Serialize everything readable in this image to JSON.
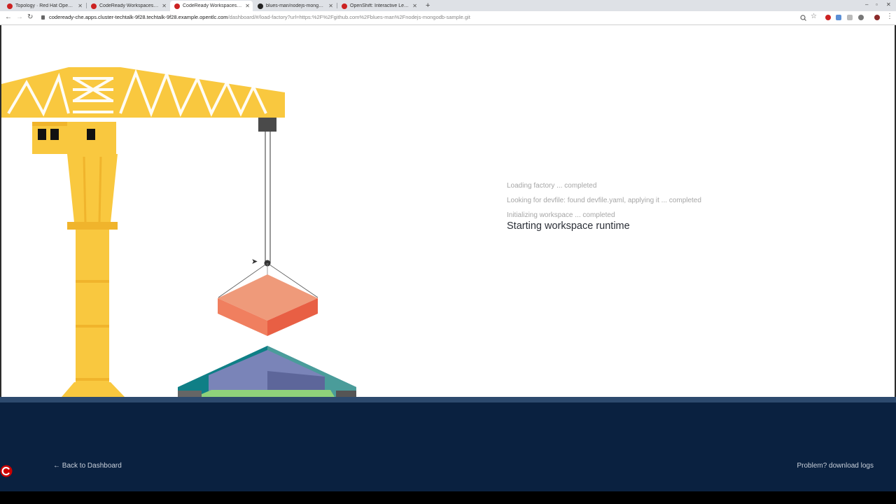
{
  "browser": {
    "tabs": [
      {
        "title": "Topology · Red Hat OpenShift",
        "favicon_color": "#cc2222",
        "active": false
      },
      {
        "title": "CodeReady Workspaces | Dashboard",
        "favicon_color": "#cc2222",
        "active": false
      },
      {
        "title": "CodeReady Workspaces | Factory",
        "favicon_color": "#cc2222",
        "active": true
      },
      {
        "title": "blues-man/nodejs-mongodb-sample",
        "favicon_color": "#222222",
        "active": false
      },
      {
        "title": "OpenShift: Interactive Learning",
        "favicon_color": "#cc2222",
        "active": false
      }
    ],
    "new_tab": "+",
    "url_host": "codeready-che.apps.cluster-techtalk-9f28.techtalk-9f28.example.opentlc.com",
    "url_path": "/dashboard/#/load-factory?url=https:%2F%2Fgithub.com%2Fblues-man%2Fnodejs-mongodb-sample.git"
  },
  "status": {
    "steps": [
      "Loading factory ... completed",
      "Looking for devfile: found devfile.yaml, applying it ... completed",
      "Initializing workspace ... completed"
    ],
    "current": "Starting workspace runtime"
  },
  "footer": {
    "back_label": "← Back to Dashboard",
    "logs_label": "Problem? download logs"
  },
  "icons": {
    "back": "back-arrow-icon",
    "forward": "forward-arrow-icon",
    "reload": "reload-icon",
    "lock": "lock-icon",
    "zoom": "zoom-icon",
    "star": "bookmark-star-icon",
    "logo": "che-logo-icon"
  },
  "colors": {
    "crane": "#f9c83f",
    "crane_shadow": "#f0b42c",
    "box_top": "#ef9a7a",
    "box_left": "#f07f5f",
    "box_right": "#e85f44",
    "footer": "#0a2140",
    "accent_red": "#cc0000"
  }
}
